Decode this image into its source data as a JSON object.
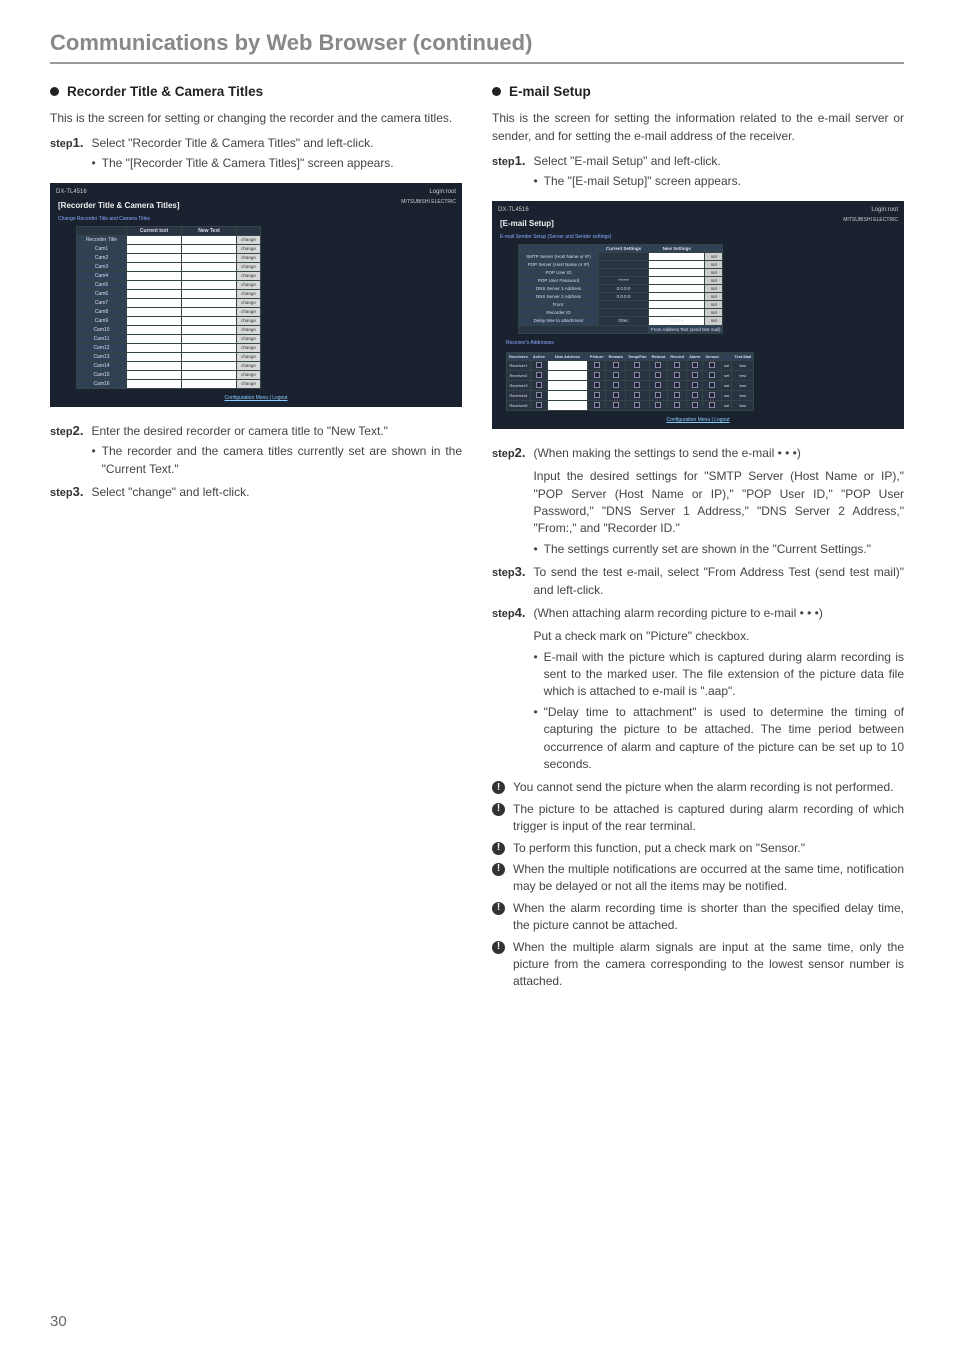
{
  "page_title": "Communications by Web Browser (continued)",
  "page_number": "30",
  "left": {
    "heading": "Recorder Title & Camera Titles",
    "para1": "This is the screen for setting or changing the recorder and the camera titles.",
    "step1": "Select \"Recorder Title & Camera Titles\" and left-click.",
    "step1_sub": "The \"[Recorder Title & Camera Titles]\" screen appears.",
    "step2": "Enter the desired recorder or camera title to \"New Text.\"",
    "step2_sub": "The recorder and the camera titles currently set are shown in the \"Current Text.\"",
    "step3": "Select \"change\" and left-click.",
    "mockup": {
      "product": "DX-TL4516",
      "login_user": "Login:root",
      "brand": "MITSUBISHI ELECTRIC",
      "title": "[Recorder Title & Camera Titles]",
      "subtitle": "Change Recorder Title and Camera Titles",
      "cols": [
        "",
        "Current text",
        "New Text",
        ""
      ],
      "rows": [
        "Recorder Title",
        "Cam1",
        "Cam2",
        "Cam3",
        "Cam4",
        "Cam5",
        "Cam6",
        "Cam7",
        "Cam8",
        "Cam9",
        "Cam10",
        "Cam11",
        "Cam12",
        "Cam13",
        "Cam14",
        "Cam15",
        "Cam16"
      ],
      "button": "change",
      "footer_links": "Configuration Menu | Logout"
    }
  },
  "right": {
    "heading": "E-mail Setup",
    "para1": "This is the screen for setting the information related to the e-mail server or sender, and for setting the e-mail address of the receiver.",
    "step1": "Select \"E-mail Setup\" and left-click.",
    "step1_sub": "The \"[E-mail Setup]\" screen appears.",
    "step2_intro": "(When making the settings to send the e-mail • • •)",
    "step2_body": "Input the desired settings for \"SMTP Server (Host Name or IP),\" \"POP Server (Host Name or IP),\" \"POP User ID,\" \"POP User Password,\" \"DNS Server 1 Address,\" \"DNS Server 2 Address,\" \"From:,\" and \"Recorder ID.\"",
    "step2_sub": "The settings currently set are shown in the \"Current Settings.\"",
    "step3": "To send the test e-mail, select \"From Address Test (send test mail)\" and left-click.",
    "step4_intro": "(When attaching alarm recording picture to e-mail • • •)",
    "step4_body": "Put a check mark on \"Picture\" checkbox.",
    "step4_sub1": "E-mail with the picture which is captured during alarm recording is sent to the marked user. The file extension of the picture data file which is attached to e-mail is \".aap\".",
    "step4_sub2": "\"Delay time to attachment\" is used to determine the timing of capturing the picture to be attached. The time period between occurrence of alarm and capture of the picture can be set up to 10 seconds.",
    "notes": [
      "You cannot send the picture when the alarm recording is not performed.",
      "The picture to be attached is captured during alarm recording of which trigger is input of the rear terminal.",
      "To perform this function, put a check mark on \"Sensor.\"",
      "When the multiple notifications are occurred at the same time, notification may be delayed or not all the items may be notified.",
      "When the alarm recording time is shorter than the specified delay time, the picture cannot be attached.",
      "When the multiple alarm signals are input at the same time, only the picture from the camera corresponding to the lowest sensor number is attached."
    ],
    "mockup": {
      "product": "DX-TL4516",
      "login_user": "Login:root",
      "brand": "MITSUBISHI ELECTRIC",
      "title": "[E-mail Setup]",
      "subtitle": "E-mail Sender Setup (Server and Sender settings)",
      "cols": [
        "",
        "Current Settings",
        "New Settings",
        ""
      ],
      "server_rows": [
        {
          "label": "SMTP Server (Host Name or IP)",
          "cur": "",
          "btn": "set"
        },
        {
          "label": "POP Server (Host Name or IP)",
          "cur": "",
          "btn": "set"
        },
        {
          "label": "POP User ID",
          "cur": "",
          "btn": "set"
        },
        {
          "label": "POP User Password",
          "cur": "******",
          "btn": "set"
        },
        {
          "label": "DNS Server 1 Address",
          "cur": "0.0.0.0",
          "btn": "set"
        },
        {
          "label": "DNS Server 2 Address",
          "cur": "0.0.0.0",
          "btn": "set"
        },
        {
          "label": "From:",
          "cur": "",
          "btn": "set"
        },
        {
          "label": "Recorder ID",
          "cur": "",
          "btn": "set"
        },
        {
          "label": "Delay time to attachment",
          "cur": "0Sec",
          "new": "0Sec ▾",
          "btn": "set"
        }
      ],
      "test_label": "From Address Test (send test mail)",
      "receiver_heading": "Receiver's Addresses",
      "receiver_cols": [
        "Receivers",
        "Active",
        "New Address",
        "Picture",
        "Remain",
        "Temp/Fan",
        "Reboot",
        "Record",
        "Alarm",
        "Sensor",
        "",
        "Test Mail"
      ],
      "receiver_rows": [
        "Receiver1",
        "Receiver2",
        "Receiver3",
        "Receiver4",
        "Receiver5"
      ],
      "set_btn": "set",
      "test_btn": "test",
      "footer_links": "Configuration Menu | Logout"
    }
  }
}
